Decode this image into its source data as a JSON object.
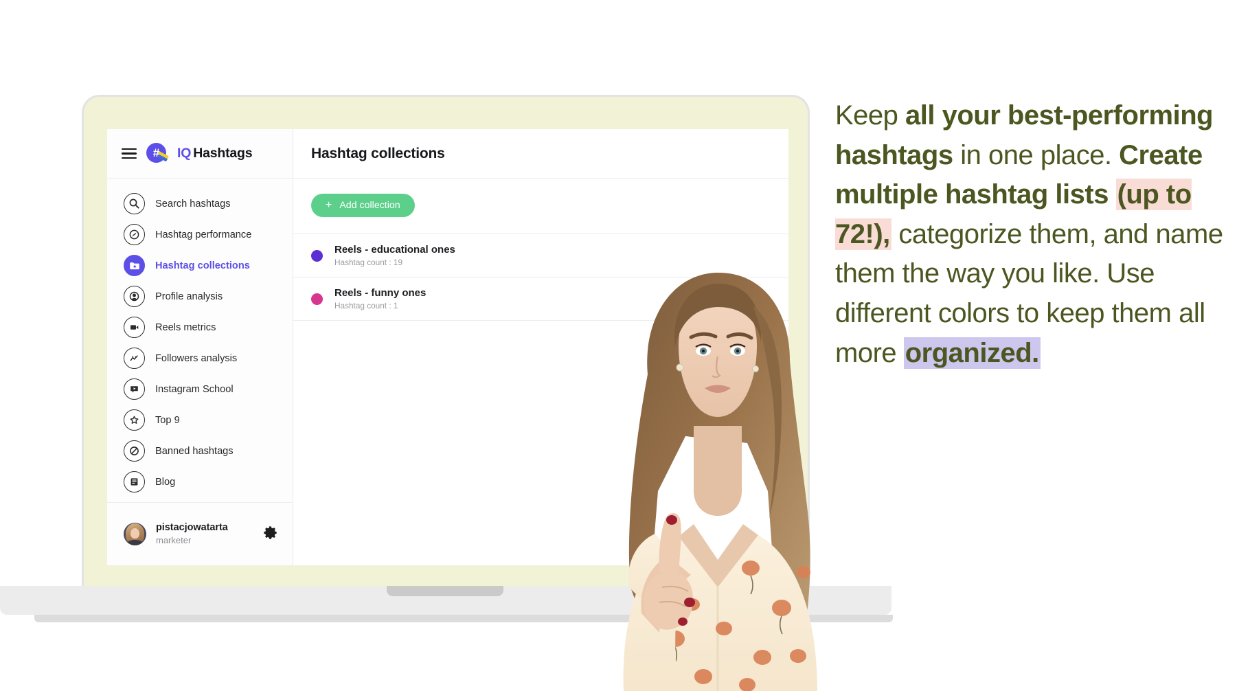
{
  "app": {
    "brand": {
      "iq": "IQ",
      "name": "Hashtags"
    },
    "menu_icon": "hamburger-icon"
  },
  "sidebar": {
    "items": [
      {
        "label": "Search hashtags",
        "icon": "search-icon",
        "active": false
      },
      {
        "label": "Hashtag performance",
        "icon": "speedometer-icon",
        "active": false
      },
      {
        "label": "Hashtag collections",
        "icon": "folder-star-icon",
        "active": true
      },
      {
        "label": "Profile analysis",
        "icon": "person-icon",
        "active": false
      },
      {
        "label": "Reels metrics",
        "icon": "video-camera-icon",
        "active": false
      },
      {
        "label": "Followers analysis",
        "icon": "trend-line-icon",
        "active": false
      },
      {
        "label": "Instagram School",
        "icon": "play-board-icon",
        "active": false
      },
      {
        "label": "Top 9",
        "icon": "star-icon",
        "active": false
      },
      {
        "label": "Banned hashtags",
        "icon": "no-entry-icon",
        "active": false
      },
      {
        "label": "Blog",
        "icon": "article-icon",
        "active": false
      }
    ],
    "profile": {
      "username": "pistacjowatarta",
      "role": "marketer",
      "settings_icon": "gear-icon",
      "avatar": "avatar"
    }
  },
  "main": {
    "title": "Hashtag collections",
    "add_button": {
      "label": "Add collection",
      "plus": "+"
    },
    "collections": [
      {
        "name": "Reels - educational ones",
        "count_label": "Hashtag count : 19",
        "color": "#5b2fd4"
      },
      {
        "name": "Reels - funny ones",
        "count_label": "Hashtag count : 1",
        "color": "#d6368f"
      }
    ]
  },
  "copy": {
    "s1": "Keep ",
    "s2": "all your best-performing hashtags",
    "s3": " in one place. ",
    "s4": "Create multiple hashtag lists ",
    "s5": "(up to 72!),",
    "s6": " categorize them, and name them the way you like. Use different colors to keep them all more ",
    "s7": "organized."
  },
  "colors": {
    "brand_purple": "#5c4fe8",
    "accent_green": "#5ccf8a",
    "copy_green": "#4b5620",
    "highlight_pink": "#fadcd6",
    "highlight_purple": "#cdc6ed",
    "laptop_bezel": "#f1f2d6"
  }
}
